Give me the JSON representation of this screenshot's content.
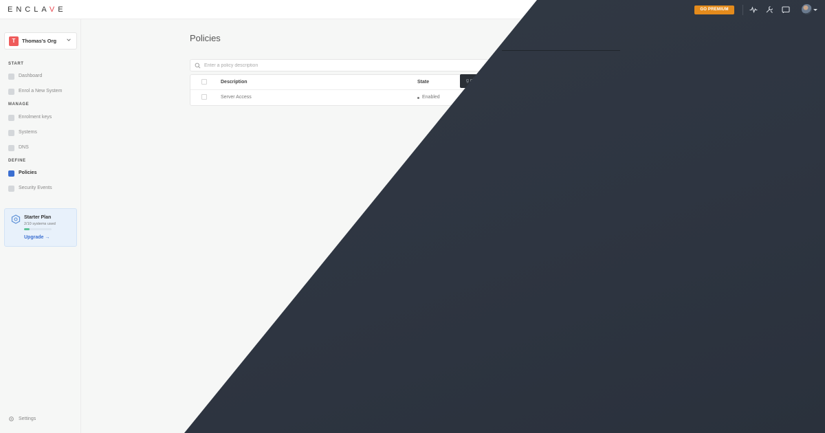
{
  "brand": {
    "logo_text": "ENCLA",
    "logo_accent": "V",
    "logo_tail": "E",
    "accent_color": "#e8474f"
  },
  "org": {
    "initial": "T",
    "name": "Thomas's Org"
  },
  "sidebar": {
    "sections": {
      "start": "START",
      "manage": "MANAGE",
      "define": "DEFINE"
    },
    "items": [
      {
        "label": "Dashboard",
        "icon": "send-icon"
      },
      {
        "label": "Enrol a New System",
        "icon": "enrol-icon"
      },
      {
        "label": "Enrolment keys",
        "icon": "key-icon"
      },
      {
        "label": "Systems",
        "icon": "monitor-icon"
      },
      {
        "label": "DNS",
        "icon": "globe-icon"
      },
      {
        "label": "Policies",
        "icon": "policy-icon",
        "active": true
      },
      {
        "label": "Security Events",
        "icon": "shield-icon"
      }
    ],
    "settings_label": "Settings"
  },
  "plan": {
    "title": "Starter Plan",
    "usage": "2/10 systems used",
    "usage_fraction": 0.2,
    "upgrade_label": "Upgrade →"
  },
  "main": {
    "title": "Policies",
    "search_placeholder": "Enter a policy description",
    "table": {
      "columns": [
        "Description",
        "State"
      ],
      "rows": [
        {
          "description": "Server Access",
          "state": "Enabled"
        }
      ]
    },
    "toast_text": "g played"
  },
  "topbar": {
    "premium_label": "GO PREMIUM",
    "premium_color": "#e48b1c",
    "icons": [
      "activity-icon",
      "tools-icon",
      "cast-icon"
    ]
  }
}
